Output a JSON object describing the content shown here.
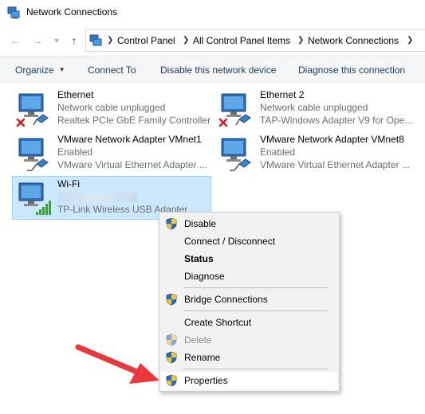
{
  "window": {
    "title": "Network Connections",
    "app_icon": "network-connections-icon"
  },
  "address": {
    "breadcrumbs": [
      "Control Panel",
      "All Control Panel Items",
      "Network Connections"
    ]
  },
  "toolbar": {
    "organize": "Organize",
    "connect_to": "Connect To",
    "disable": "Disable this network device",
    "diagnose": "Diagnose this connection"
  },
  "connections": [
    {
      "name": "Ethernet",
      "status": "Network cable unplugged",
      "device": "Realtek PCIe GbE Family Controller",
      "state_icon": "red-x-icon"
    },
    {
      "name": "Ethernet 2",
      "status": "Network cable unplugged",
      "device": "TAP-Windows Adapter V9 for Ope...",
      "state_icon": "red-x-icon"
    },
    {
      "name": "VMware Network Adapter VMnet1",
      "status": "Enabled",
      "device": "VMware Virtual Ethernet Adapter ...",
      "state_icon": "cable-icon"
    },
    {
      "name": "VMware Network Adapter VMnet8",
      "status": "Enabled",
      "device": "VMware Virtual Ethernet Adapter ...",
      "state_icon": "cable-icon"
    },
    {
      "name": "Wi-Fi",
      "status": "",
      "device": "TP-Link Wireless USB Adapter",
      "state_icon": "signal-bars-icon"
    }
  ],
  "context_menu": {
    "items": [
      {
        "label": "Disable",
        "shield": true
      },
      {
        "label": "Connect / Disconnect",
        "shield": false
      },
      {
        "label": "Status",
        "shield": false,
        "bold": true
      },
      {
        "label": "Diagnose",
        "shield": false
      },
      {
        "label": "Bridge Connections",
        "shield": true
      },
      {
        "label": "Create Shortcut",
        "shield": false
      },
      {
        "label": "Delete",
        "shield": true,
        "disabled": true
      },
      {
        "label": "Rename",
        "shield": true
      },
      {
        "label": "Properties",
        "shield": true,
        "highlighted": true
      }
    ]
  },
  "colors": {
    "selection": "#cce8ff",
    "selection_border": "#99d1ff",
    "toolbar_text": "#1e395b",
    "arrow": "#e8383d"
  }
}
